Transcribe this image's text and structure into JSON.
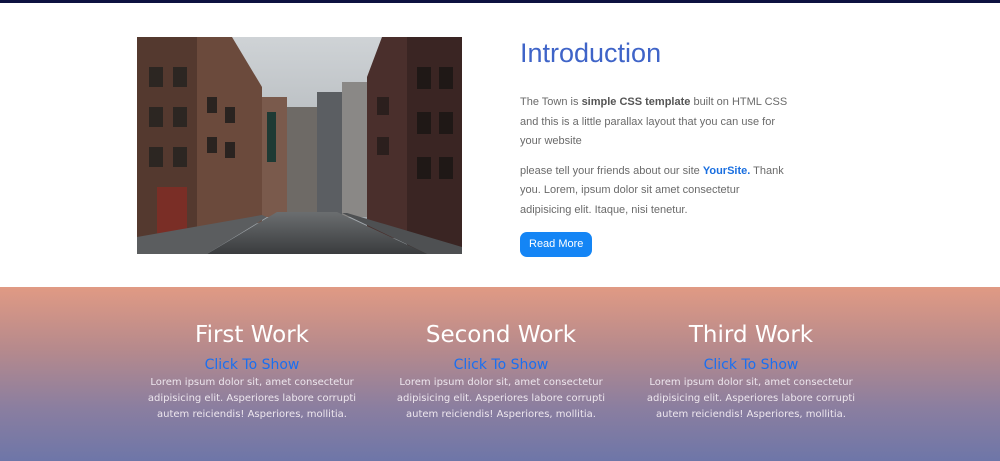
{
  "intro": {
    "title": "Introduction",
    "p1_prefix": "The Town is ",
    "p1_bold": "simple CSS template",
    "p1_suffix": " built on HTML CSS and this is a little parallax layout that you can use for your website",
    "p2_prefix": "please tell your friends about our site ",
    "p2_brand": "YourSite.",
    "p2_suffix": " Thank you. Lorem, ipsum dolor sit amet consectetur adipisicing elit. Itaque, nisi tenetur.",
    "button_label": "Read More",
    "image_alt": "street with old brick buildings"
  },
  "works": [
    {
      "title": "First Work",
      "link": "Click To Show",
      "desc": "Lorem ipsum dolor sit, amet consectetur adipisicing elit. Asperiores labore corrupti autem reiciendis! Asperiores, mollitia."
    },
    {
      "title": "Second Work",
      "link": "Click To Show",
      "desc": "Lorem ipsum dolor sit, amet consectetur adipisicing elit. Asperiores labore corrupti autem reiciendis! Asperiores, mollitia."
    },
    {
      "title": "Third Work",
      "link": "Click To Show",
      "desc": "Lorem ipsum dolor sit, amet consectetur adipisicing elit. Asperiores labore corrupti autem reiciendis! Asperiores, mollitia."
    }
  ],
  "colors": {
    "accent": "#3f64c8",
    "button": "#1485f5",
    "link": "#1a6ff0",
    "gradient_top": "#e09a84",
    "gradient_bottom": "#6e76a8"
  }
}
